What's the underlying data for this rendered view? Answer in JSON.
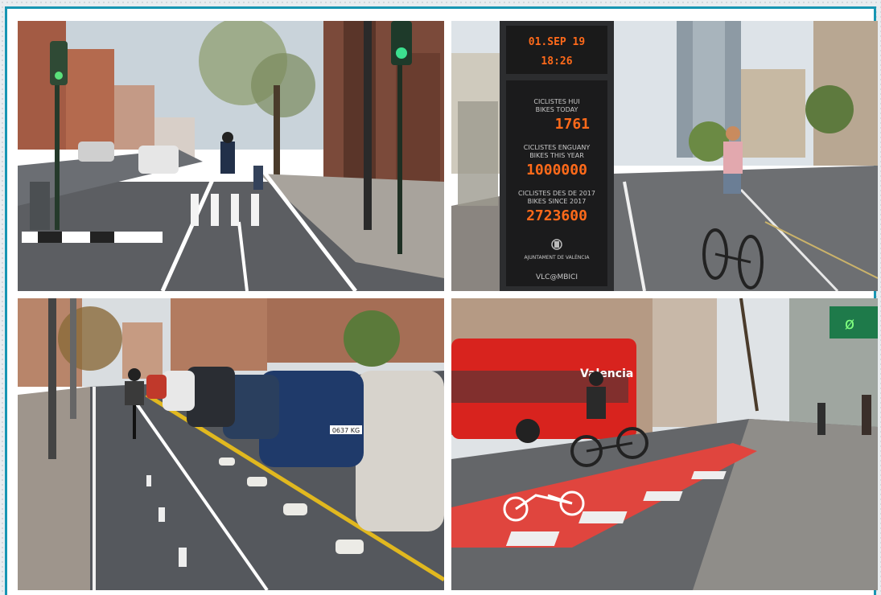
{
  "counter": {
    "date": "01.SEP 19",
    "time": "18:26",
    "label_today_1": "CICLISTES HUI",
    "label_today_2": "BIKES TODAY",
    "value_today": "1761",
    "label_year_1": "CICLISTES ENGUANY",
    "label_year_2": "BIKES THIS YEAR",
    "value_year": "1000000",
    "label_since_1": "CICLISTES DES DE 2017",
    "label_since_2": "BIKES SINCE 2017",
    "value_since": "2723600",
    "org": "AJUNTAMENT DE VALÈNCIA",
    "brand": "VLC@MBICI"
  },
  "bus": {
    "text": "Valencia"
  },
  "plate": {
    "text": "0637 KG"
  },
  "sign": {
    "text": "ø"
  },
  "colors": {
    "frame": "#1796b3",
    "bike_lane_red": "#e0453e",
    "led": "#ff6a1a"
  }
}
